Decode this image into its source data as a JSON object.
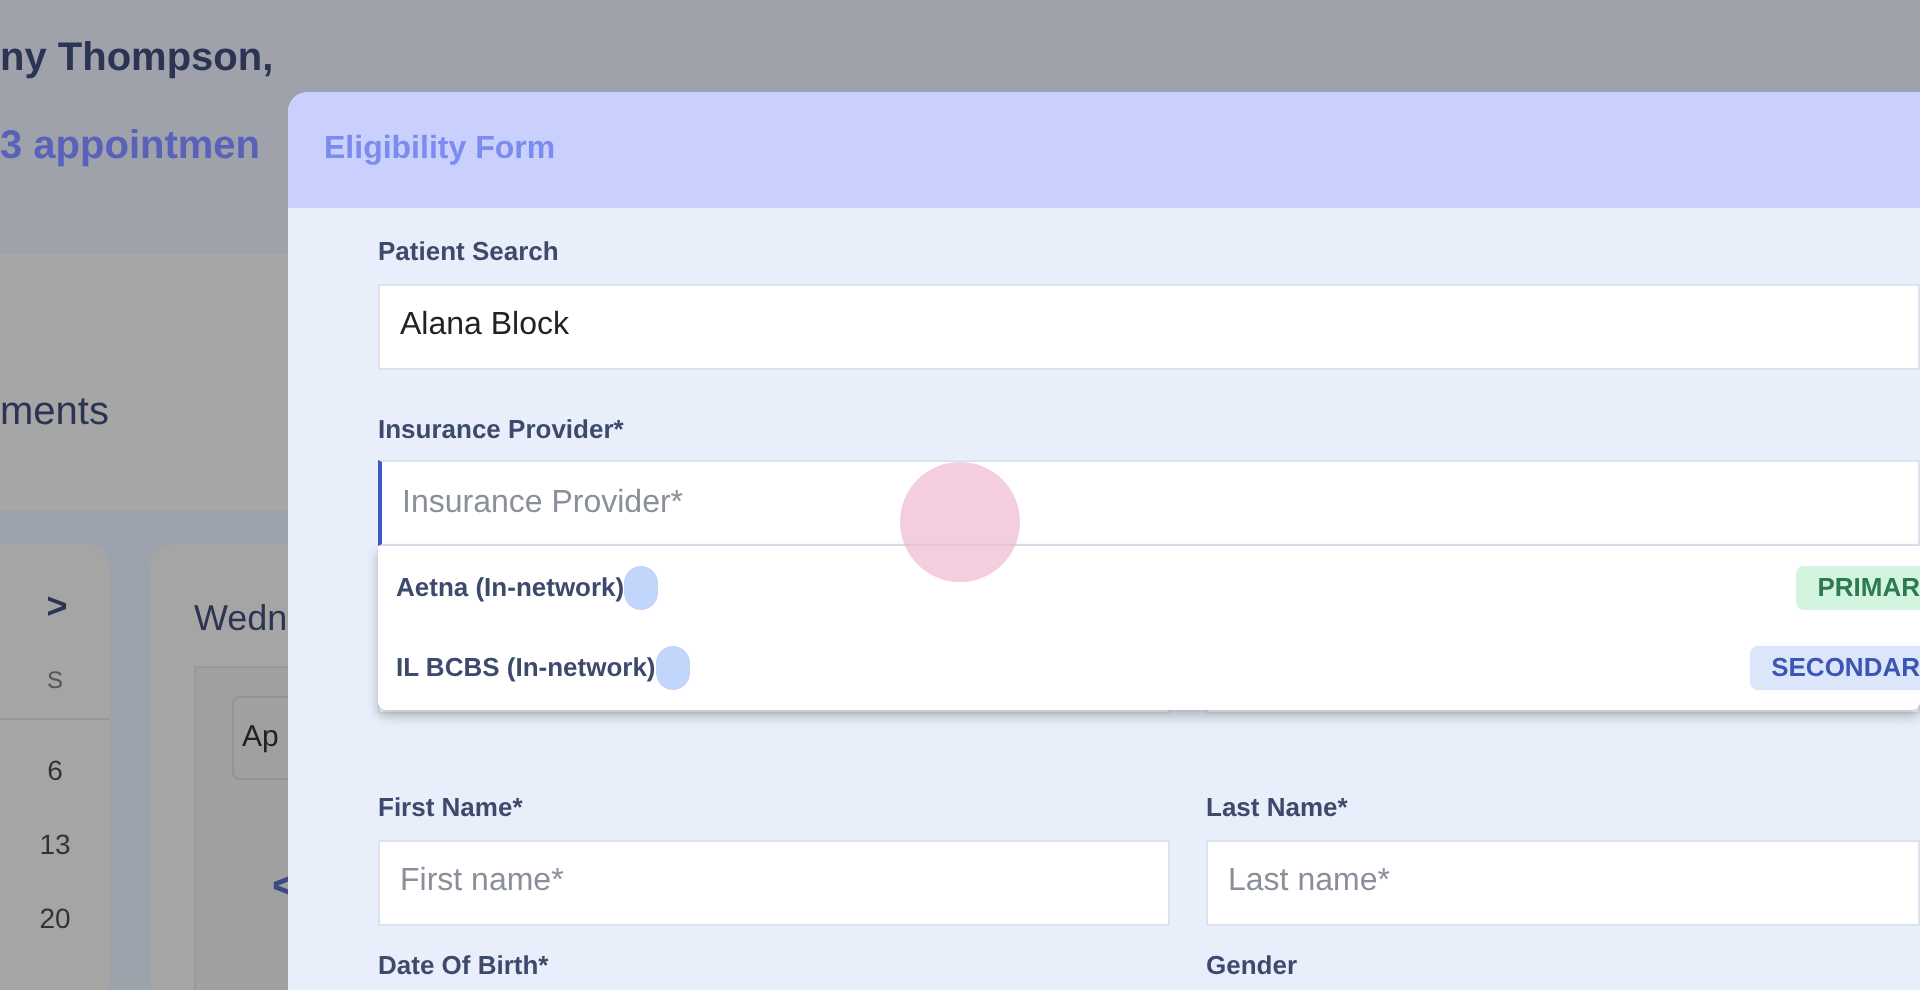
{
  "background": {
    "greeting": "ny Thompson,",
    "appointments_note": "3 appointmen",
    "section_title": "ments",
    "calendar": {
      "next_label": ">",
      "weekday": "S",
      "dates": [
        "6",
        "13",
        "20"
      ]
    },
    "day_panel": {
      "title": "Wedn",
      "field_value": "Ap",
      "prev_label": "<"
    }
  },
  "modal": {
    "title": "Eligibility Form",
    "patient_search": {
      "label": "Patient Search",
      "value": "Alana Block"
    },
    "insurance_provider": {
      "label": "Insurance Provider*",
      "placeholder": "Insurance Provider*",
      "options": [
        {
          "label": "Aetna (In-network)",
          "badge": "PRIMAR",
          "kind": "primary"
        },
        {
          "label": "IL BCBS (In-network)",
          "badge": "SECONDAR",
          "kind": "secondary"
        }
      ]
    },
    "first_name": {
      "label": "First Name*",
      "placeholder": "First name*"
    },
    "last_name": {
      "label": "Last Name*",
      "placeholder": "Last name*"
    },
    "date_of_birth": {
      "label": "Date Of Birth*"
    },
    "gender": {
      "label": "Gender"
    }
  }
}
